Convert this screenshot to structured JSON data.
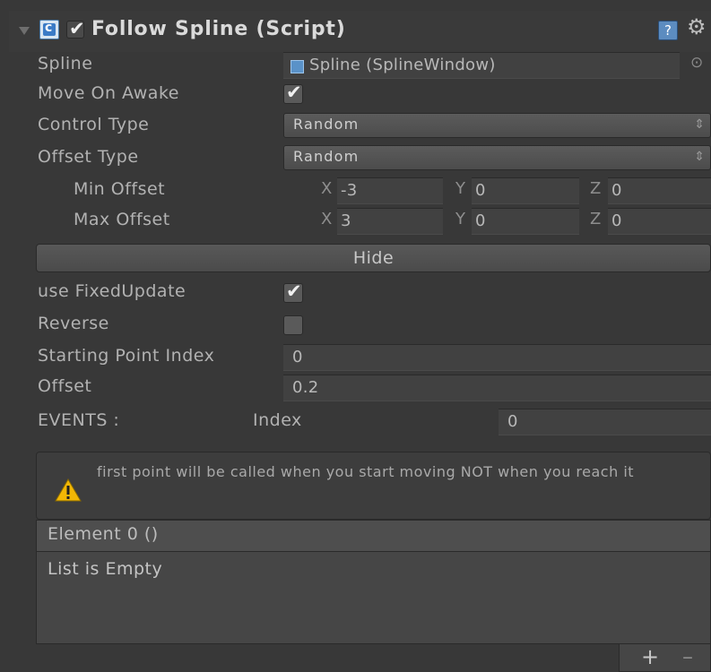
{
  "component": {
    "title": "Follow Spline (Script)",
    "enabled": true,
    "icons": {
      "collapse": "triangle-down-icon",
      "script": "script-icon",
      "help": "help-icon",
      "settings": "gear-icon"
    }
  },
  "fields": {
    "spline_label": "Spline",
    "spline_value": "Spline (SplineWindow)",
    "move_on_awake_label": "Move On Awake",
    "move_on_awake": true,
    "control_type_label": "Control Type",
    "control_type_value": "Random",
    "offset_type_label": "Offset Type",
    "offset_type_value": "Random",
    "min_offset_label": "Min Offset",
    "min_offset": {
      "x": "-3",
      "y": "0",
      "z": "0"
    },
    "max_offset_label": "Max Offset",
    "max_offset": {
      "x": "3",
      "y": "0",
      "z": "0"
    },
    "axis_x": "X",
    "axis_y": "Y",
    "axis_z": "Z",
    "hide_button": "Hide",
    "use_fixed_update_label": "use FixedUpdate",
    "use_fixed_update": true,
    "reverse_label": "Reverse",
    "reverse": false,
    "starting_point_index_label": "Starting Point Index",
    "starting_point_index": "0",
    "offset_label": "Offset",
    "offset_value": "0.2"
  },
  "events": {
    "label": "EVENTS :",
    "index_label": "Index",
    "index_value": "0",
    "warning": "first point will be called when you start moving NOT when you reach it",
    "element_header": "Element 0 ()",
    "list_empty": "List is Empty",
    "add_label": "+",
    "remove_label": "–"
  }
}
